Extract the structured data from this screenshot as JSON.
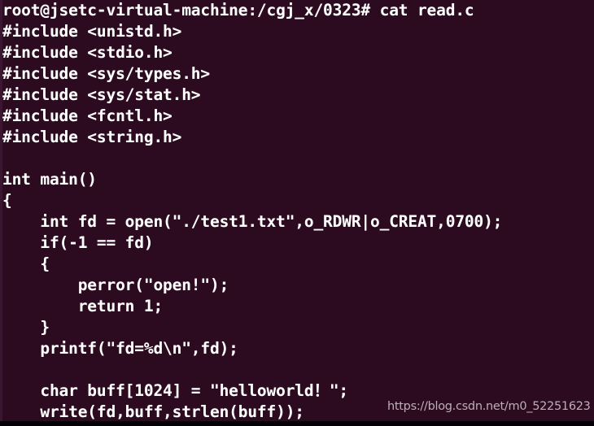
{
  "terminal": {
    "background_color": "#2C0A20",
    "text_color": "#FFFFFF",
    "prompt_line": "root@jsetc-virtual-machine:/cgj_x/0323# cat read.c",
    "command": "cat read.c",
    "user": "root",
    "host": "jsetc-virtual-machine",
    "cwd": "/cgj_x/0323",
    "lines": [
      "root@jsetc-virtual-machine:/cgj_x/0323# cat read.c",
      "#include <unistd.h>",
      "#include <stdio.h>",
      "#include <sys/types.h>",
      "#include <sys/stat.h>",
      "#include <fcntl.h>",
      "#include <string.h>",
      "",
      "int main()",
      "{",
      "    int fd = open(\"./test1.txt\",o_RDWR|o_CREAT,0700);",
      "    if(-1 == fd)",
      "    {",
      "        perror(\"open!\");",
      "        return 1;",
      "    }",
      "    printf(\"fd=%d\\n\",fd);",
      "",
      "    char buff[1024] = \"helloworld！\";",
      "    write(fd,buff,strlen(buff));"
    ]
  },
  "watermark": {
    "text": "https://blog.csdn.net/m0_52251623",
    "color": "#C9BCC6"
  }
}
